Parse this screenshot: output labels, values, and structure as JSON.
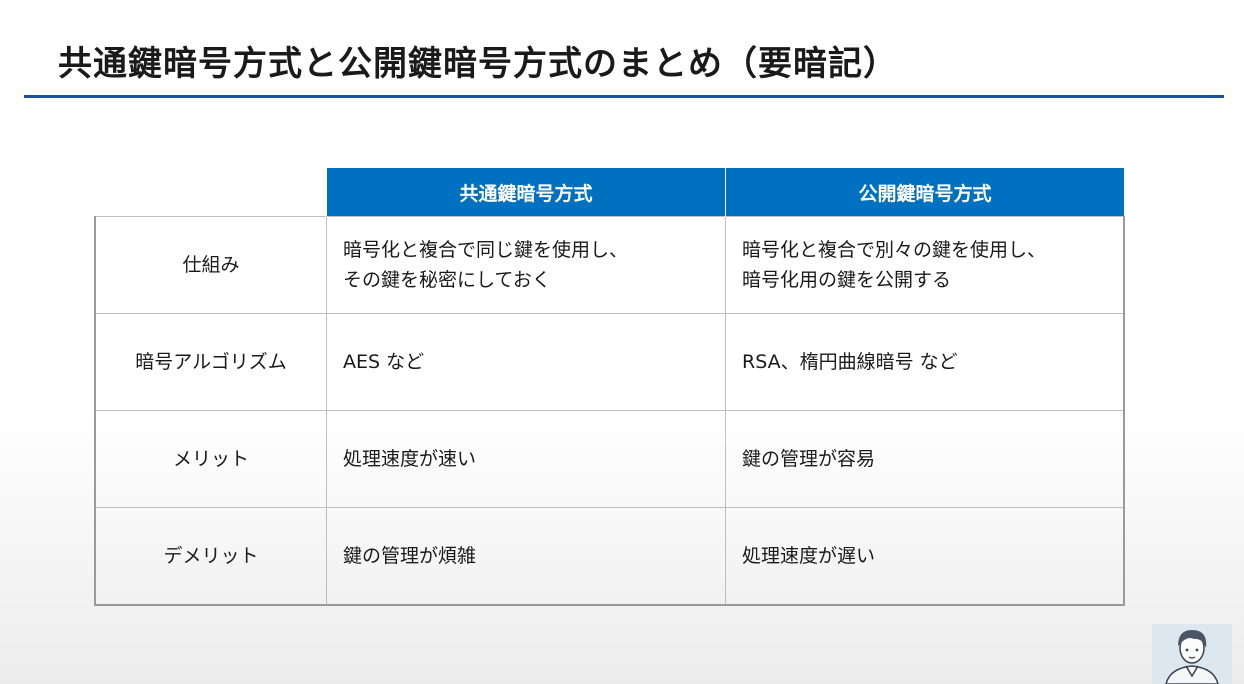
{
  "slide": {
    "title": "共通鍵暗号方式と公開鍵暗号方式のまとめ（要暗記）",
    "accent_color": "#1f4e9c",
    "header_color": "#0070c0"
  },
  "table": {
    "columns": [
      "共通鍵暗号方式",
      "公開鍵暗号方式"
    ],
    "rows": [
      {
        "label": "仕組み",
        "common": [
          "暗号化と複合で同じ鍵を使用し、",
          "その鍵を秘密にしておく"
        ],
        "public": [
          "暗号化と複合で別々の鍵を使用し、",
          "暗号化用の鍵を公開する"
        ]
      },
      {
        "label": "暗号アルゴリズム",
        "common": [
          "AES など"
        ],
        "public": [
          "RSA、楕円曲線暗号 など"
        ]
      },
      {
        "label": "メリット",
        "common": [
          "処理速度が速い"
        ],
        "public": [
          "鍵の管理が容易"
        ]
      },
      {
        "label": "デメリット",
        "common": [
          "鍵の管理が煩雑"
        ],
        "public": [
          "処理速度が遅い"
        ]
      }
    ]
  },
  "presenter": {
    "icon": "presenter-avatar-icon"
  }
}
